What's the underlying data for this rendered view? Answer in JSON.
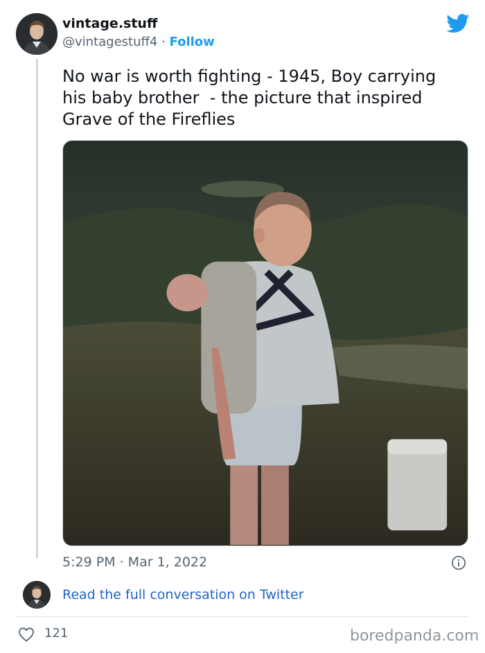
{
  "tweet": {
    "display_name": "vintage.stuff",
    "handle": "@vintagestuff4",
    "separator": " · ",
    "follow_label": "Follow",
    "text": "No war is worth fighting - 1945, Boy carrying\nhis baby brother  - the picture that inspired\nGrave of the Fireflies",
    "timestamp": "5:29 PM · Mar 1, 2022",
    "read_link": "Read the full conversation on Twitter",
    "like_count": "121",
    "brand_color": "#1d9bf0"
  },
  "icons": {
    "logo": "twitter-bird-icon",
    "info": "info-icon",
    "like": "heart-icon"
  },
  "watermark": "boredpanda.com"
}
